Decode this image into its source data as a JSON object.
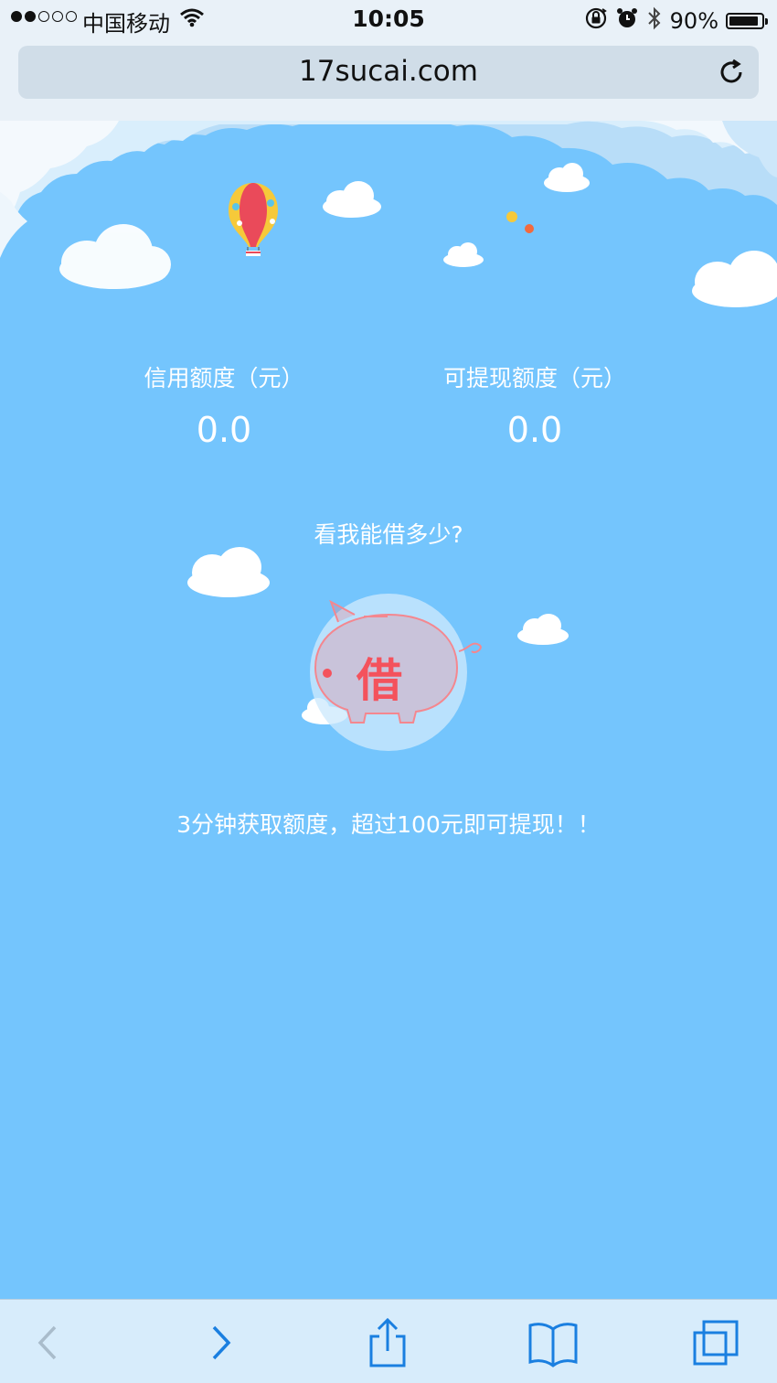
{
  "status_bar": {
    "carrier": "中国移动",
    "time": "10:05",
    "battery": "90%",
    "signal_bars_filled": 2,
    "signal_bars_total": 5,
    "battery_level": 0.9
  },
  "browser": {
    "url": "17sucai.com"
  },
  "page": {
    "credit_label": "信用额度（元）",
    "credit_value": "0.0",
    "withdraw_label": "可提现额度（元）",
    "withdraw_value": "0.0",
    "prompt": "看我能借多少?",
    "borrow_button": "借",
    "footnote": "3分钟获取额度，超过100元即可提现！！"
  },
  "colors": {
    "sky": "#74c5fd",
    "accent": "#f4525c",
    "toolbar_icon": "#1a7fe0"
  },
  "icons": [
    "wifi-icon",
    "orientation-lock-icon",
    "alarm-icon",
    "bluetooth-icon",
    "battery-icon",
    "reload-icon",
    "back-icon",
    "forward-icon",
    "share-icon",
    "bookmarks-icon",
    "tabs-icon",
    "balloon-icon",
    "piggy-bank-icon"
  ]
}
